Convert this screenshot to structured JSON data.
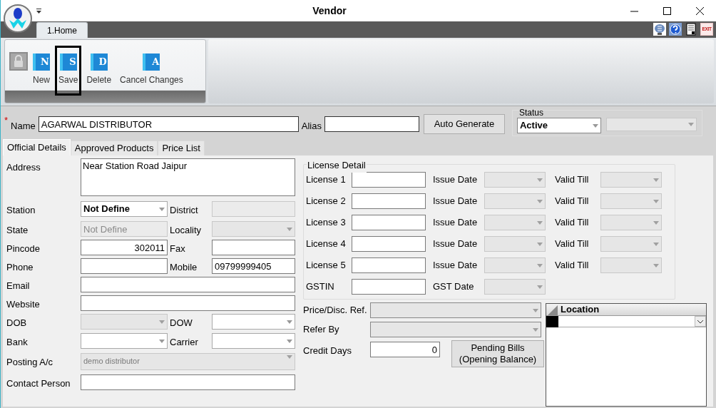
{
  "window": {
    "title": "Vendor"
  },
  "ribbon": {
    "tabs": [
      {
        "label": "1.Home",
        "selected": true
      }
    ],
    "buttons": [
      {
        "label": "New",
        "letter": "N",
        "selected": false
      },
      {
        "label": "Save",
        "letter": "S",
        "selected": true
      },
      {
        "label": "Delete",
        "letter": "D",
        "selected": false
      },
      {
        "label": "Cancel Changes",
        "letter": "A",
        "selected": false
      }
    ]
  },
  "toolbar_icons": [
    {
      "kind": "monitor"
    },
    {
      "kind": "help"
    },
    {
      "kind": "document"
    },
    {
      "kind": "exit",
      "label": "EXIT"
    }
  ],
  "header": {
    "required_mark": "*",
    "name": {
      "label": "Name",
      "value": "AGARWAL DISTRIBUTOR"
    },
    "alias": {
      "label": "Alias"
    },
    "auto_generate_button": "Auto Generate",
    "status": {
      "legend": "Status",
      "value": "Active",
      "second_disabled": true
    }
  },
  "tabs": [
    {
      "label": "Official Details",
      "selected": true
    },
    {
      "label": "Approved Products",
      "selected": false
    },
    {
      "label": "Price List",
      "selected": false
    }
  ],
  "left_rows": [
    {
      "fields": [
        {
          "label": "Address",
          "kind": "textarea",
          "value": "Near Station Road Jaipur",
          "disabled": false
        }
      ]
    },
    {
      "fields": [
        {
          "label": "Station",
          "kind": "select",
          "value": "Not Define",
          "bold": true,
          "disabled": false
        },
        {
          "label": "District",
          "kind": "text",
          "disabled": true
        }
      ]
    },
    {
      "fields": [
        {
          "label": "State",
          "kind": "text",
          "value": "Not Define",
          "disabled": true
        },
        {
          "label": "Locality",
          "kind": "select",
          "disabled": true
        }
      ]
    },
    {
      "fields": [
        {
          "label": "Pincode",
          "kind": "text",
          "value": "302011",
          "numeric": true,
          "disabled": false
        },
        {
          "label": "Fax",
          "kind": "text",
          "disabled": false
        }
      ]
    },
    {
      "fields": [
        {
          "label": "Phone",
          "kind": "text",
          "disabled": false
        },
        {
          "label": "Mobile",
          "kind": "text",
          "value": "09799999405",
          "disabled": false
        }
      ]
    },
    {
      "fields": [
        {
          "label": "Email",
          "kind": "text",
          "disabled": false
        }
      ]
    },
    {
      "fields": [
        {
          "label": "Website",
          "kind": "text",
          "disabled": false
        }
      ]
    },
    {
      "fields": [
        {
          "label": "DOB",
          "kind": "select",
          "disabled": true
        },
        {
          "label": "DOW",
          "kind": "select",
          "disabled": false
        }
      ]
    },
    {
      "fields": [
        {
          "label": "Bank",
          "kind": "select",
          "disabled": false
        },
        {
          "label": "Carrier",
          "kind": "select",
          "disabled": false
        }
      ]
    },
    {
      "fields": [
        {
          "label": "Posting A/c",
          "kind": "select",
          "value": "demo distributor",
          "disabled": true
        }
      ]
    },
    {
      "fields": [
        {
          "label": "Contact Person",
          "kind": "text",
          "disabled": false
        }
      ]
    }
  ],
  "license_detail": {
    "legend": "License Detail",
    "rows": [
      {
        "label": "License 1",
        "date_label": "Issue Date",
        "till_label": "Valid Till"
      },
      {
        "label": "License 2",
        "date_label": "Issue Date",
        "till_label": "Valid Till"
      },
      {
        "label": "License 3",
        "date_label": "Issue Date",
        "till_label": "Valid Till"
      },
      {
        "label": "License 4",
        "date_label": "Issue Date",
        "till_label": "Valid Till"
      },
      {
        "label": "License 5",
        "date_label": "Issue Date",
        "till_label": "Valid Till"
      },
      {
        "label": "GSTIN",
        "date_label": "GST Date"
      }
    ]
  },
  "price_ref": {
    "label": "Price/Disc. Ref."
  },
  "refer_by": {
    "label": "Refer By"
  },
  "credit_days": {
    "label": "Credit Days",
    "value": "0"
  },
  "pending_bills_button": "Pending Bills\n(Opening Balance)",
  "location_grid": {
    "columns": [
      "Location"
    ]
  }
}
